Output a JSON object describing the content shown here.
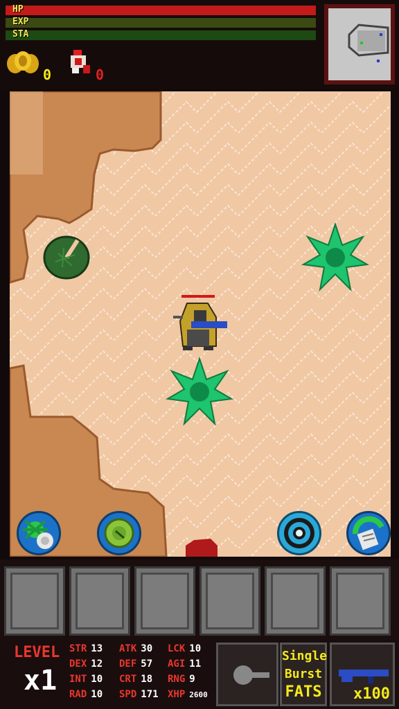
{
  "hud": {
    "hp_label": "HP",
    "exp_label": "EXP",
    "sta_label": "STA",
    "hp_level": 1.0,
    "exp_level": 1.0,
    "sta_level": 1.0,
    "gold_count": "0",
    "meat_count": "0"
  },
  "stats": {
    "level_label": "LEVEL",
    "level_multiplier": "x1",
    "rows": [
      [
        {
          "k": "STR",
          "v": "13"
        },
        {
          "k": "ATK",
          "v": "30"
        },
        {
          "k": "LCK",
          "v": "10"
        }
      ],
      [
        {
          "k": "DEX",
          "v": "12"
        },
        {
          "k": "DEF",
          "v": "57"
        },
        {
          "k": "AGI",
          "v": "11"
        }
      ],
      [
        {
          "k": "INT",
          "v": "10"
        },
        {
          "k": "CRT",
          "v": "18"
        },
        {
          "k": "RNG",
          "v": "9"
        }
      ],
      [
        {
          "k": "RAD",
          "v": "10"
        },
        {
          "k": "SPD",
          "v": "171"
        },
        {
          "k": "XHP",
          "v": "2600"
        }
      ]
    ]
  },
  "fire_mode": {
    "line1": "Single",
    "line2": "Burst",
    "line3": "FATS"
  },
  "weapon": {
    "ammo": "x100"
  },
  "colors": {
    "hp": "#c31a1a",
    "exp": "#3b4a12",
    "sta": "#1d4a12",
    "sand": "#f0c8a4",
    "dirt": "#c98752",
    "accent_yellow": "#f3ea1b",
    "stat_red": "#e8372f"
  },
  "icons": [
    "gold-coins-icon",
    "meat-icon",
    "minimap",
    "player-character",
    "green-star-enemy",
    "lily-pad",
    "blood-splat",
    "ability-spider-icon",
    "ability-green-orb-icon",
    "ability-ring-icon",
    "ability-scroll-icon",
    "weapon-slot-icon",
    "rifle-icon"
  ]
}
